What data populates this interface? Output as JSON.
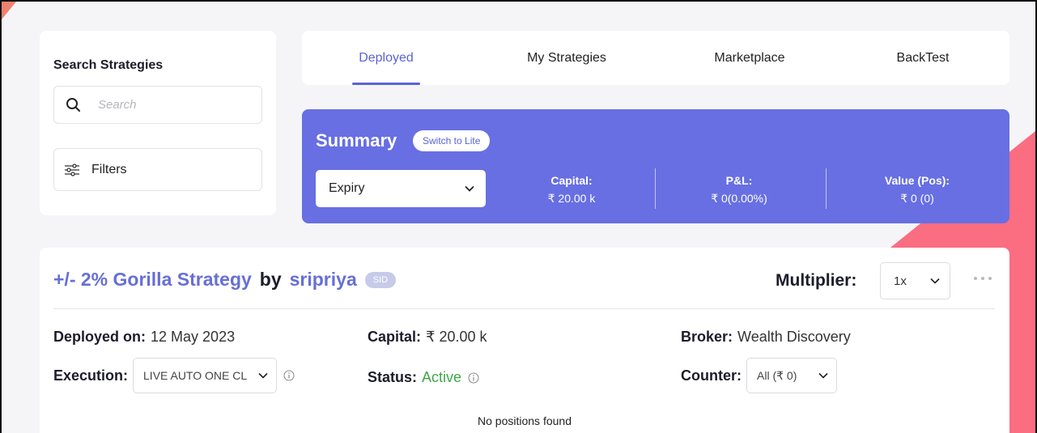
{
  "sidebar": {
    "title": "Search Strategies",
    "search_placeholder": "Search",
    "filters_label": "Filters"
  },
  "tabs": [
    {
      "label": "Deployed",
      "active": true
    },
    {
      "label": "My Strategies",
      "active": false
    },
    {
      "label": "Marketplace",
      "active": false
    },
    {
      "label": "BackTest",
      "active": false
    }
  ],
  "summary": {
    "title": "Summary",
    "switch_label": "Switch to Lite",
    "expiry_selected": "Expiry",
    "capital_label": "Capital:",
    "capital_value": "₹ 20.00 k",
    "pnl_label": "P&L:",
    "pnl_value": "₹ 0(0.00%)",
    "value_label": "Value (Pos):",
    "value_value": "₹ 0 (0)"
  },
  "strategy": {
    "name": "+/- 2% Gorilla Strategy",
    "by": "by",
    "author": "sripriya",
    "badge": "SID",
    "multiplier_label": "Multiplier:",
    "multiplier_value": "1x",
    "deployed_label": "Deployed on:",
    "deployed_value": "12 May 2023",
    "capital_label": "Capital:",
    "capital_value": "₹ 20.00 k",
    "broker_label": "Broker:",
    "broker_value": "Wealth Discovery",
    "execution_label": "Execution:",
    "execution_value": "LIVE AUTO ONE CL",
    "status_label": "Status:",
    "status_value": "Active",
    "counter_label": "Counter:",
    "counter_value": "All (₹ 0)",
    "empty_message": "No positions found"
  },
  "colors": {
    "accent": "#676fe3",
    "link": "#666fd6",
    "active_status": "#3fa64a",
    "decor": "#fb6d80"
  }
}
